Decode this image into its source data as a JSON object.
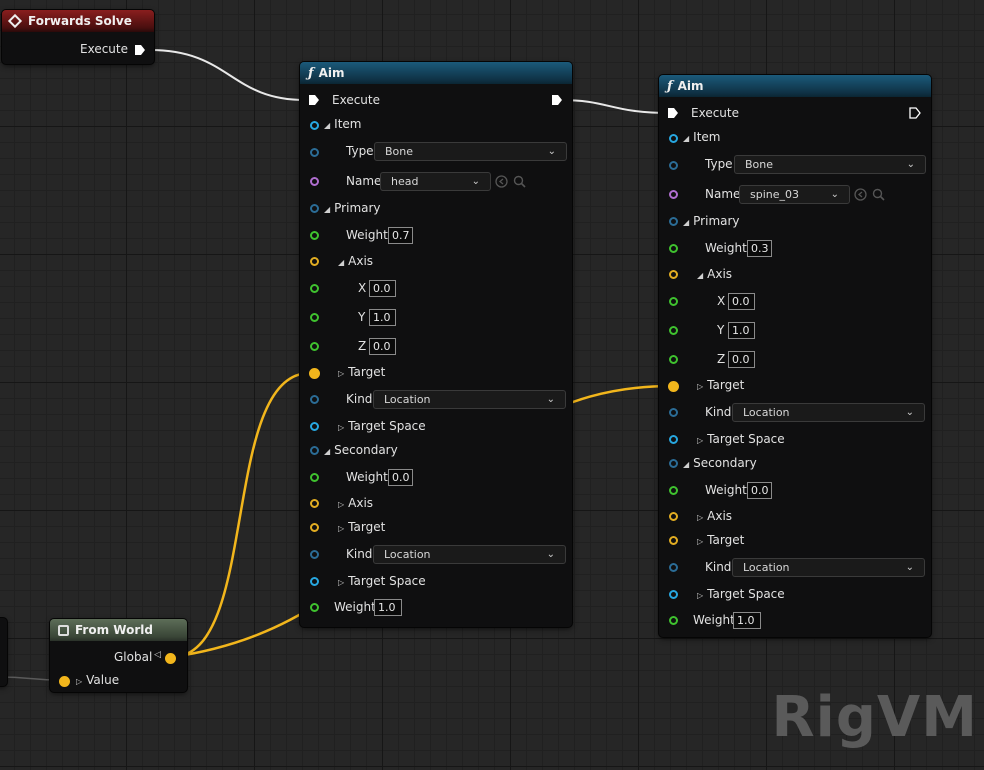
{
  "forwards_solve": {
    "title": "Forwards Solve",
    "execute": "Execute"
  },
  "aim_nodes": [
    {
      "title": "Aim",
      "execute": "Execute",
      "item": "Item",
      "type_label": "Type",
      "type_value": "Bone",
      "name_label": "Name",
      "name_value": "head",
      "primary": "Primary",
      "weight_label": "Weight",
      "primary_weight": "0.7",
      "axis": "Axis",
      "x_label": "X",
      "x": "0.0",
      "y_label": "Y",
      "y": "1.0",
      "z_label": "Z",
      "z": "0.0",
      "target": "Target",
      "kind_label": "Kind",
      "kind_value": "Location",
      "target_space": "Target Space",
      "secondary": "Secondary",
      "secondary_weight": "0.0",
      "secondary_kind_value": "Location",
      "weight": "1.0"
    },
    {
      "title": "Aim",
      "execute": "Execute",
      "item": "Item",
      "type_label": "Type",
      "type_value": "Bone",
      "name_label": "Name",
      "name_value": "spine_03",
      "primary": "Primary",
      "weight_label": "Weight",
      "primary_weight": "0.3",
      "axis": "Axis",
      "x_label": "X",
      "x": "0.0",
      "y_label": "Y",
      "y": "1.0",
      "z_label": "Z",
      "z": "0.0",
      "target": "Target",
      "kind_label": "Kind",
      "kind_value": "Location",
      "target_space": "Target Space",
      "secondary": "Secondary",
      "secondary_weight": "0.0",
      "secondary_kind_value": "Location",
      "weight": "1.0"
    }
  ],
  "from_world": {
    "title": "From World",
    "global": "Global",
    "value": "Value"
  },
  "watermark": "RigVM",
  "colors": {
    "exec": "#ffffff",
    "transform": "#f2b61c",
    "vector": "#e2ad22",
    "float": "#3fc22f",
    "struct": "#27a7e0",
    "name": "#b06ed0",
    "header_function": "#1b5a7a",
    "header_event": "#8a1e1e"
  }
}
